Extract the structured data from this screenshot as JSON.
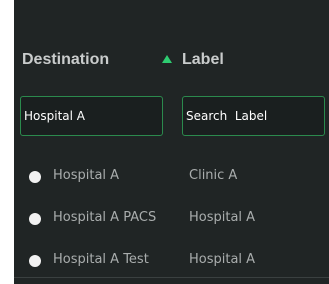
{
  "table": {
    "headers": {
      "destination": "Destination",
      "label": "Label"
    },
    "sort": {
      "column": "label",
      "direction": "ascending",
      "icon": "sort-ascending-icon"
    },
    "filters": {
      "destination_value": "Hospital A",
      "label_placeholder": "Search  Label"
    },
    "rows": [
      {
        "destination": "Hospital A",
        "label": "Clinic A"
      },
      {
        "destination": "Hospital A PACS",
        "label": "Hospital A"
      },
      {
        "destination": "Hospital A Test",
        "label": "Hospital A"
      }
    ]
  },
  "colors": {
    "panel_background": "#202525",
    "accent_green": "#2ecc71",
    "input_border": "#2b8a4d",
    "header_text": "#c9cccc",
    "cell_text": "#a9adad"
  }
}
